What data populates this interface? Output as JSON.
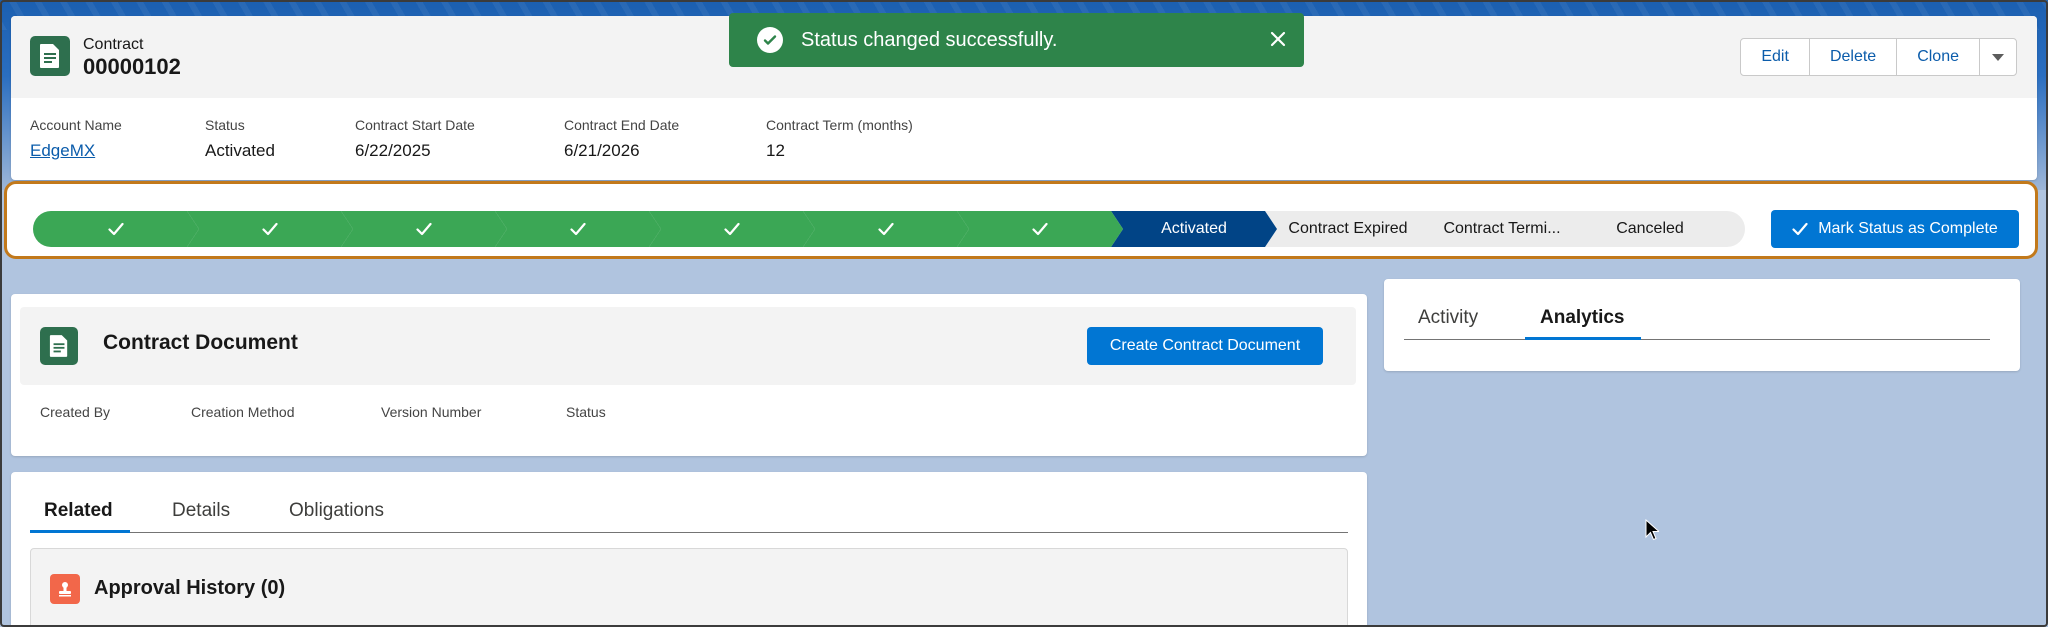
{
  "header": {
    "object_type": "Contract",
    "record_name": "00000102",
    "actions": [
      "Edit",
      "Delete",
      "Clone"
    ],
    "menu_icon": "chevron-down-icon",
    "fields": [
      {
        "label": "Account Name",
        "value": "EdgeMX",
        "link": true
      },
      {
        "label": "Status",
        "value": "Activated",
        "link": false
      },
      {
        "label": "Contract Start Date",
        "value": "6/22/2025",
        "link": false
      },
      {
        "label": "Contract End Date",
        "value": "6/21/2026",
        "link": false
      },
      {
        "label": "Contract Term (months)",
        "value": "12",
        "link": false
      }
    ]
  },
  "toast": {
    "message": "Status changed successfully.",
    "type": "success",
    "icon": "check-circle-icon",
    "close_icon": "close-icon"
  },
  "path": {
    "stages": [
      {
        "label": "",
        "state": "done"
      },
      {
        "label": "",
        "state": "done"
      },
      {
        "label": "",
        "state": "done"
      },
      {
        "label": "",
        "state": "done"
      },
      {
        "label": "",
        "state": "done"
      },
      {
        "label": "",
        "state": "done"
      },
      {
        "label": "",
        "state": "done"
      },
      {
        "label": "Activated",
        "state": "current"
      },
      {
        "label": "Contract Expired",
        "state": "future"
      },
      {
        "label": "Contract Termi...",
        "state": "future"
      },
      {
        "label": "Canceled",
        "state": "future"
      }
    ],
    "mark_button": "Mark Status as Complete"
  },
  "contract_document": {
    "title": "Contract Document",
    "create_button": "Create Contract Document",
    "columns": [
      "Created By",
      "Creation Method",
      "Version Number",
      "Status"
    ]
  },
  "related": {
    "tabs": [
      "Related",
      "Details",
      "Obligations"
    ],
    "active_tab": "Related",
    "approval_history": "Approval History (0)"
  },
  "side": {
    "tabs": [
      "Activity",
      "Analytics"
    ],
    "active_tab": "Analytics"
  },
  "colors": {
    "brand": "#0176d3",
    "done": "#3ba755",
    "current": "#014486",
    "toast": "#2e844a",
    "highlight": "#c2791b"
  }
}
